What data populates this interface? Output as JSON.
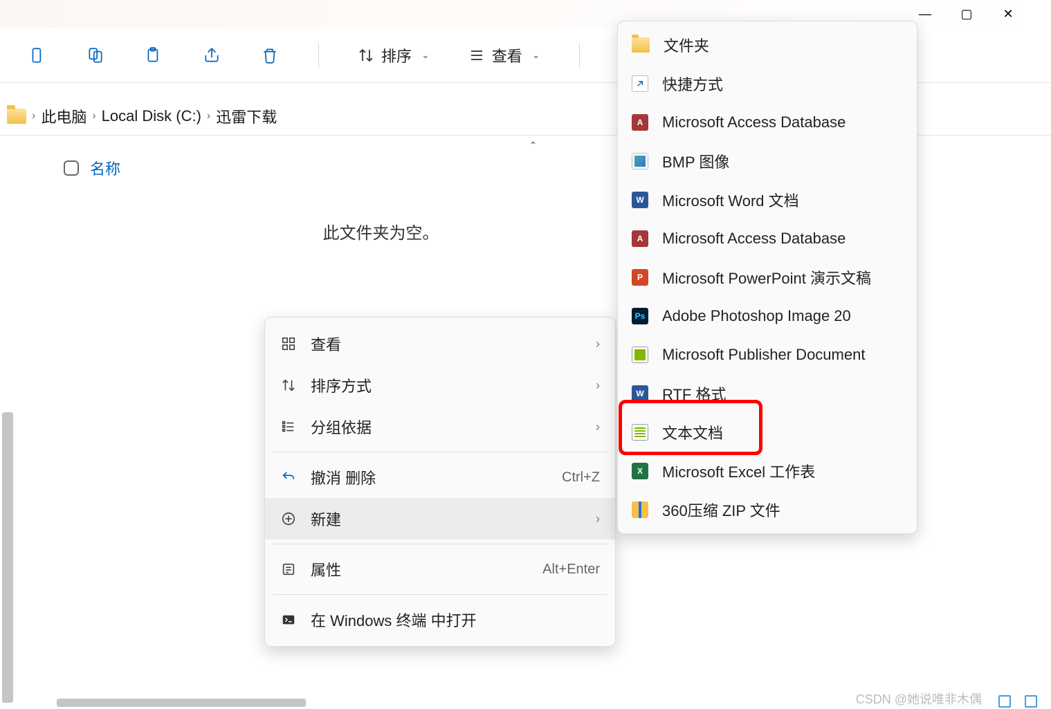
{
  "window_controls": {
    "min": "—",
    "max": "▢",
    "close": "✕"
  },
  "toolbar": {
    "sort": "排序",
    "view": "查看"
  },
  "breadcrumb": [
    "此电脑",
    "Local Disk (C:)",
    "迅雷下载"
  ],
  "column_name": "名称",
  "column_count": "0",
  "empty_folder": "此文件夹为空。",
  "context_menu": {
    "view": "查看",
    "sort": "排序方式",
    "group": "分组依据",
    "undo": "撤消 删除",
    "undo_shortcut": "Ctrl+Z",
    "new": "新建",
    "properties": "属性",
    "properties_shortcut": "Alt+Enter",
    "terminal": "在 Windows 终端 中打开"
  },
  "new_menu": [
    {
      "icon": "folder",
      "label": "文件夹"
    },
    {
      "icon": "shortcut",
      "label": "快捷方式"
    },
    {
      "icon": "access",
      "label": "Microsoft Access Database"
    },
    {
      "icon": "bmp",
      "label": "BMP 图像"
    },
    {
      "icon": "word",
      "label": "Microsoft Word 文档"
    },
    {
      "icon": "access",
      "label": "Microsoft Access Database"
    },
    {
      "icon": "ppt",
      "label": "Microsoft PowerPoint 演示文稿"
    },
    {
      "icon": "ps",
      "label": "Adobe Photoshop Image 20"
    },
    {
      "icon": "pub",
      "label": "Microsoft Publisher Document"
    },
    {
      "icon": "rtf",
      "label": "RTF 格式"
    },
    {
      "icon": "txt",
      "label": "文本文档"
    },
    {
      "icon": "excel",
      "label": "Microsoft Excel 工作表"
    },
    {
      "icon": "zip",
      "label": "360压缩 ZIP 文件"
    }
  ],
  "watermark": "CSDN @她说唯非木偶"
}
